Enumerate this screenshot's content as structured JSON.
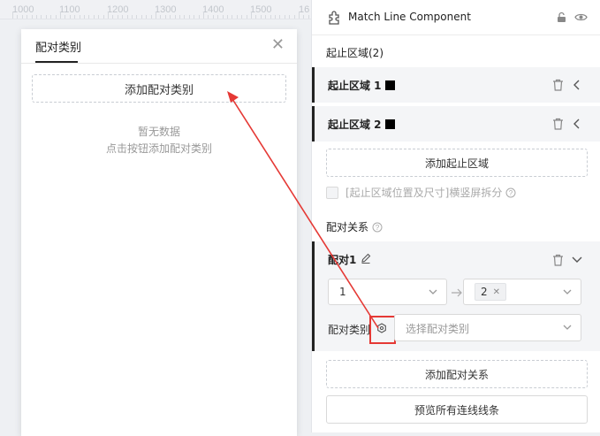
{
  "ruler": {
    "labels": [
      "1000",
      "1100",
      "1200",
      "1300",
      "1400",
      "1500",
      "16"
    ]
  },
  "modal": {
    "title": "配对类别",
    "close_icon": "close-icon",
    "add_button": "添加配对类别",
    "empty_line1": "暂无数据",
    "empty_line2": "点击按钮添加配对类别"
  },
  "panel": {
    "component_title": "Match Line Component",
    "zones_title": "起止区域(2)",
    "zones": [
      {
        "label": "起止区域 1",
        "swatch_color": "#000000"
      },
      {
        "label": "起止区域 2",
        "swatch_color": "#000000"
      }
    ],
    "add_zone_button": "添加起止区域",
    "split_checkbox_label": "[起止区域位置及尺寸]横竖屏拆分",
    "relation_title": "配对关系",
    "match": {
      "label": "配对1",
      "from_value": "1",
      "to_tag": "2",
      "category_label": "配对类别",
      "category_placeholder": "选择配对类别"
    },
    "add_relation_button": "添加配对关系",
    "preview_button": "预览所有连线线条"
  },
  "colors": {
    "annotation": "#e53935",
    "accent_dark": "#222222"
  }
}
